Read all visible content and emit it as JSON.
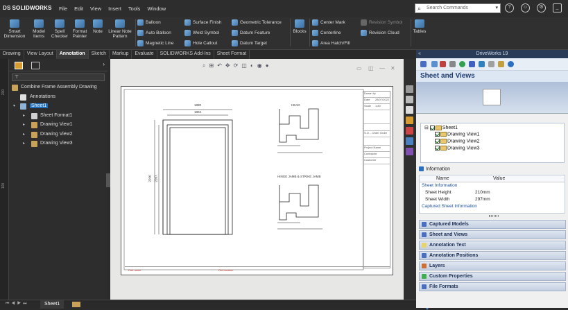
{
  "app": {
    "brand_prefix": "DS",
    "brand_name": "SOLIDWORKS"
  },
  "menu": [
    "File",
    "Edit",
    "View",
    "Insert",
    "Tools",
    "Window"
  ],
  "search": {
    "placeholder": "Search Commands"
  },
  "ribbon": {
    "large_buttons": [
      {
        "label1": "Smart",
        "label2": "Dimension"
      },
      {
        "label1": "Model",
        "label2": "Items"
      },
      {
        "label1": "Spell",
        "label2": "Checker"
      },
      {
        "label1": "Format",
        "label2": "Painter"
      },
      {
        "label1": "Note",
        "label2": ""
      },
      {
        "label1": "Linear Note",
        "label2": "Pattern"
      }
    ],
    "col1": [
      "Balloon",
      "Auto Balloon",
      "Magnetic Line"
    ],
    "col2": [
      "Surface Finish",
      "Weld Symbol",
      "Hole Callout"
    ],
    "col3": [
      "Geometric Tolerance",
      "Datum Feature",
      "Datum Target"
    ],
    "blocks": "Blocks",
    "col4": [
      "Center Mark",
      "Centerline",
      "Area Hatch/Fill"
    ],
    "col5": [
      "Revision Symbol",
      "Revision Cloud"
    ],
    "tables": "Tables"
  },
  "tabs": [
    "Drawing",
    "View Layout",
    "Annotation",
    "Sketch",
    "Markup",
    "Evaluate",
    "SOLIDWORKS Add-Ins",
    "Sheet Format"
  ],
  "active_tab": "Annotation",
  "ruler": [
    "200",
    "100"
  ],
  "tree": {
    "root": "Combine Frame Assembly Drawing",
    "annotations": "Annotations",
    "sheet": "Sheet1",
    "children": [
      "Sheet Format1",
      "Drawing View1",
      "Drawing View2",
      "Drawing View3"
    ]
  },
  "drawing": {
    "head_label": "HEAD",
    "jamb_label": "HINGE JAMB & STRIKE JAMB",
    "dims": {
      "outer_w": "1890",
      "inner_w": "1804",
      "outer_h": "2250",
      "inner_h": "2207"
    },
    "title_block": [
      {
        "k": "Drawn by",
        "v": ""
      },
      {
        "k": "Date",
        "v": "28/07/2022"
      },
      {
        "k": "Scale",
        "v": "1:80"
      },
      {
        "k": "",
        "v": ""
      },
      {
        "k": "",
        "v": ""
      },
      {
        "k": "S.O. - Order Order",
        "v": ""
      },
      {
        "k": "",
        "v": ""
      },
      {
        "k": "Project Name",
        "v": ""
      },
      {
        "k": "Contractor",
        "v": ""
      },
      {
        "k": "Customer",
        "v": ""
      }
    ],
    "bottom_left": "Part name",
    "bottom_mid": "File location"
  },
  "bottom_tab": "Sheet1",
  "right_pane": {
    "header": "DriveWorks 19",
    "title": "Sheet and Views",
    "tree_root": "Sheet1",
    "tree_items": [
      "Drawing View1",
      "Drawing View2",
      "Drawing View3"
    ],
    "info_label": "Information",
    "col_name": "Name",
    "col_value": "Value",
    "category1": "Sheet Information",
    "rows": [
      {
        "name": "Sheet Height",
        "value": "210mm"
      },
      {
        "name": "Sheet Width",
        "value": "297mm"
      }
    ],
    "category2": "Captured Sheet Information",
    "sections": [
      "Captured Models",
      "Sheet and Views",
      "Annotation Text",
      "Annotation Positions",
      "Layers",
      "Custom Properties",
      "File Formats"
    ],
    "section_colors": [
      "#4a6fc0",
      "#4a6fc0",
      "#e8d46a",
      "#4a6fc0",
      "#d07030",
      "#3fae4f",
      "#4a6fc0"
    ]
  }
}
